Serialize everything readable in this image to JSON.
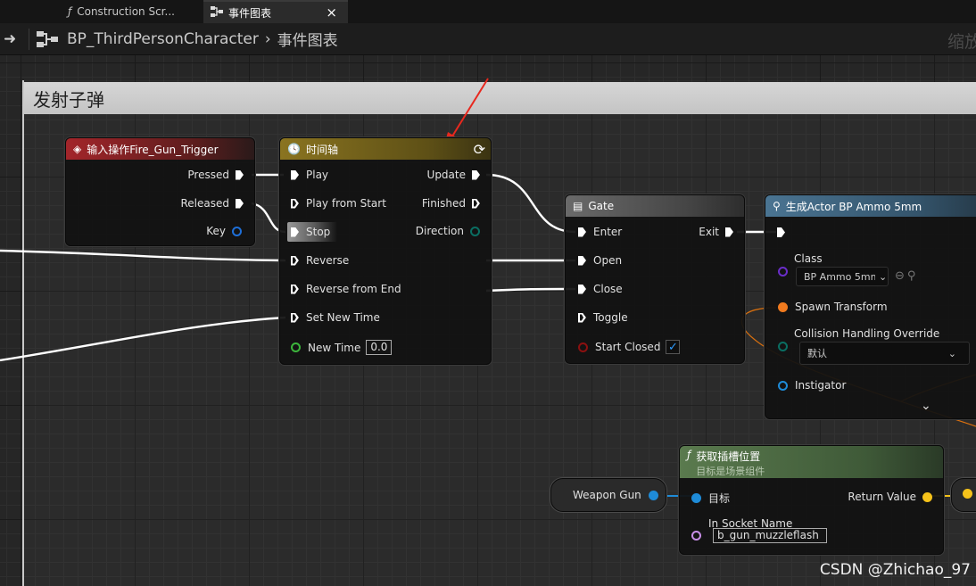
{
  "tabs": [
    {
      "icon": "ƒ",
      "label": "Construction Scr..."
    },
    {
      "icon": "",
      "label": "事件图表",
      "close": "×"
    }
  ],
  "breadcrumb": {
    "blueprint": "BP_ThirdPersonCharacter",
    "chevron": "›",
    "graph": "事件图表",
    "zoom_text": "缩放"
  },
  "comment": {
    "title": "发射子弹"
  },
  "input_node": {
    "title": "输入操作Fire_Gun_Trigger",
    "header_color": "#8b1f22",
    "pins": {
      "pressed": "Pressed",
      "released": "Released",
      "key": "Key"
    }
  },
  "timeline_node": {
    "title": "时间轴",
    "header_color": "#7a6a1c",
    "inputs": {
      "play": "Play",
      "play_from_start": "Play from Start",
      "stop": "Stop",
      "reverse": "Reverse",
      "reverse_from_end": "Reverse from End",
      "set_new_time": "Set New Time",
      "new_time": "New Time",
      "new_time_value": "0.0"
    },
    "outputs": {
      "update": "Update",
      "finished": "Finished",
      "direction": "Direction"
    }
  },
  "gate_node": {
    "title": "Gate",
    "header_color": "#5a5a5a",
    "inputs": {
      "enter": "Enter",
      "open": "Open",
      "close": "Close",
      "toggle": "Toggle",
      "start_closed": "Start Closed"
    },
    "outputs": {
      "exit": "Exit"
    },
    "start_closed_checked": "✓"
  },
  "spawn_node": {
    "title": "生成Actor BP Ammo 5mm",
    "header_color": "#3a5f79",
    "pins": {
      "class": "Class",
      "class_value": "BP Ammo 5mm",
      "spawn_transform": "Spawn Transform",
      "collision": "Collision Handling Override",
      "collision_value": "默认",
      "instigator": "Instigator"
    }
  },
  "socket_node": {
    "title": "获取插槽位置",
    "subtitle": "目标是场景组件",
    "header_color": "#4d6b43",
    "pins": {
      "target": "目标",
      "return_value": "Return Value",
      "in_socket_name": "In Socket Name",
      "socket_value": "b_gun_muzzleflash"
    }
  },
  "weapon_node": {
    "label": "Weapon Gun"
  },
  "watermark": "CSDN @Zhichao_97",
  "colors": {
    "exec": "#ffffff",
    "object": "#1e8bd8",
    "struct": "#f07a1e",
    "vector": "#f5c21a",
    "name": "#c88ee8",
    "class": "#6a2dc9",
    "bool": "#8b1010",
    "float": "#3cb53c",
    "enum": "#0a6e62"
  }
}
